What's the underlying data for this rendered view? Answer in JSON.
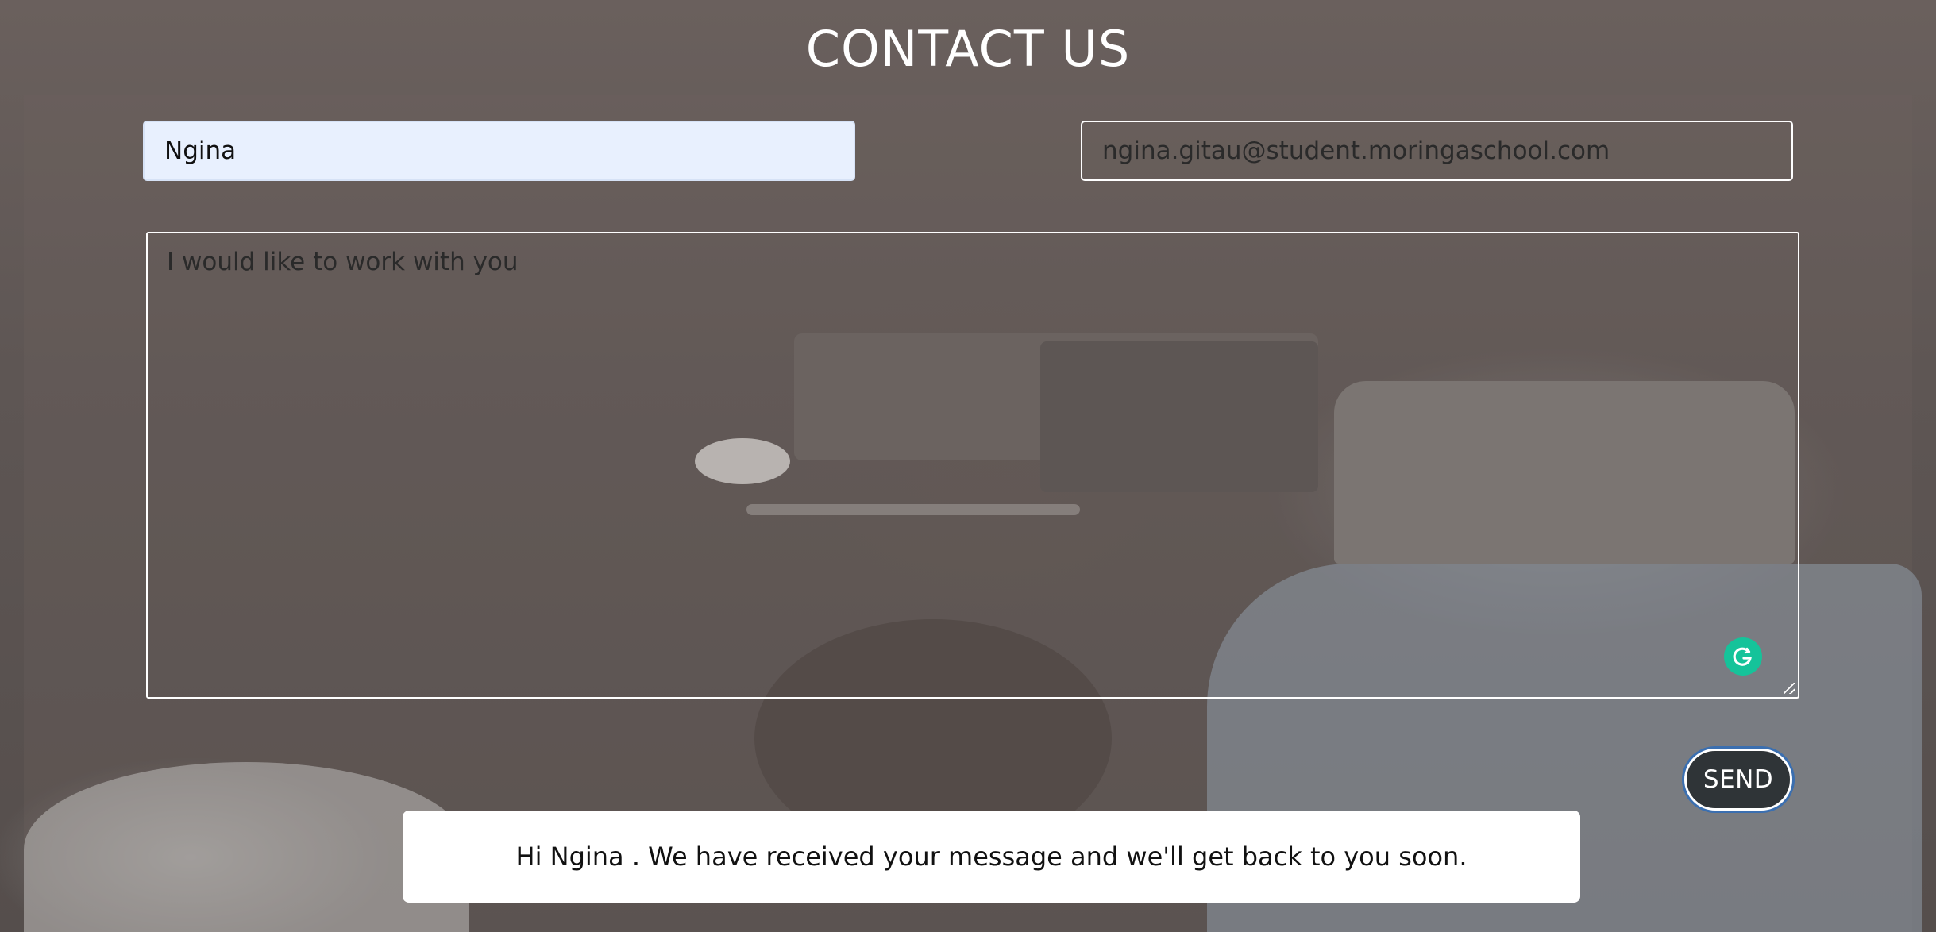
{
  "header": {
    "title": "CONTACT US"
  },
  "form": {
    "name_value": "Ngina",
    "email_value": "ngina.gitau@student.moringaschool.com",
    "message_value": "I would like to work with you",
    "send_label": "SEND"
  },
  "confirmation": {
    "text": "Hi Ngina . We have received your message and we'll get back to you soon."
  },
  "icons": {
    "grammarly": "grammarly-icon"
  },
  "colors": {
    "name_field_bg": "#e8f0fe",
    "send_button_bg": "#2f3437",
    "grammarly_green": "#15c39a",
    "confirmation_bg": "#ffffff"
  }
}
